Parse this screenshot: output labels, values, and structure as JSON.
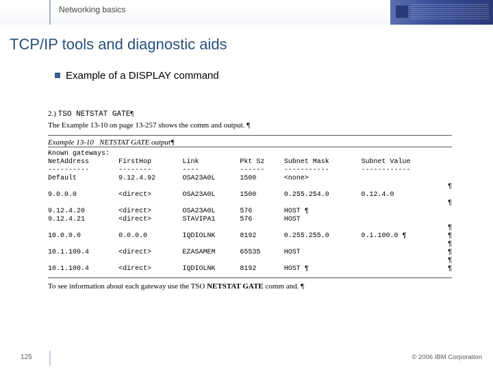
{
  "banner": {
    "label": "Networking basics"
  },
  "title": "TCP/IP tools and diagnostic aids",
  "bullet": "Example of a DISPLAY command",
  "cmd": {
    "num": "2.)",
    "text": "TSO NETSTAT GATE",
    "p": "¶"
  },
  "desc": {
    "pre": "The Example",
    "refA": "13-10 on page",
    "refB": "13-257 shows the comm and output.",
    "p": "¶"
  },
  "example": {
    "label": "Example 13-10",
    "title": "NETSTAT GATE output",
    "p": "¶"
  },
  "table": {
    "intro": "Known gateways:",
    "headers": [
      "NetAddress",
      "FirstHop",
      "Link",
      "Pkt Sz",
      "Subnet Mask",
      "Subnet Value"
    ],
    "dashes": [
      "----------",
      "--------",
      "----",
      "------",
      "-----------",
      "------------"
    ],
    "rows": [
      {
        "cols": [
          "Default",
          "9.12.4.92",
          "OSA23A0L",
          "1500",
          "<none>",
          ""
        ],
        "p": ""
      },
      {
        "cols": [
          "",
          "",
          "",
          "",
          "",
          ""
        ],
        "p": "¶"
      },
      {
        "cols": [
          "9.0.0.0",
          "<direct>",
          "OSA23A0L",
          "1500",
          "0.255.254.0",
          "0.12.4.0"
        ],
        "p": ""
      },
      {
        "cols": [
          "",
          "",
          "",
          "",
          "",
          ""
        ],
        "p": "¶"
      },
      {
        "cols": [
          "9.12.4.20",
          "<direct>",
          "OSA23A0L",
          "576",
          "HOST ¶",
          ""
        ],
        "p": ""
      },
      {
        "cols": [
          "9.12.4.21",
          "<direct>",
          "STAVIPA1",
          "576",
          "HOST",
          ""
        ],
        "p": ""
      },
      {
        "cols": [
          "",
          "",
          "",
          "",
          "",
          ""
        ],
        "p": "¶"
      },
      {
        "cols": [
          "10.0.0.0",
          "0.0.0.0",
          "IQDIOLNK",
          "8192",
          "0.255.255.0",
          "0.1.100.0 ¶"
        ],
        "p": "¶"
      },
      {
        "cols": [
          "",
          "",
          "",
          "",
          "",
          ""
        ],
        "p": "¶"
      },
      {
        "cols": [
          "10.1.100.4",
          "<direct>",
          "EZASAMEM",
          "65535",
          "HOST",
          ""
        ],
        "p": "¶"
      },
      {
        "cols": [
          "",
          "",
          "",
          "",
          "",
          ""
        ],
        "p": "¶"
      },
      {
        "cols": [
          "10.1.100.4",
          "<direct>",
          "IQDIOLNK",
          "8192",
          "HOST ¶",
          ""
        ],
        "p": "¶"
      }
    ]
  },
  "footnote": {
    "pre": "To see information about each gateway use the TSO",
    "cmd": "NETSTAT GATE",
    "post": "comm and.",
    "p": "¶"
  },
  "footer": {
    "page": "125",
    "copyright": "© 2006 IBM Corporation"
  }
}
